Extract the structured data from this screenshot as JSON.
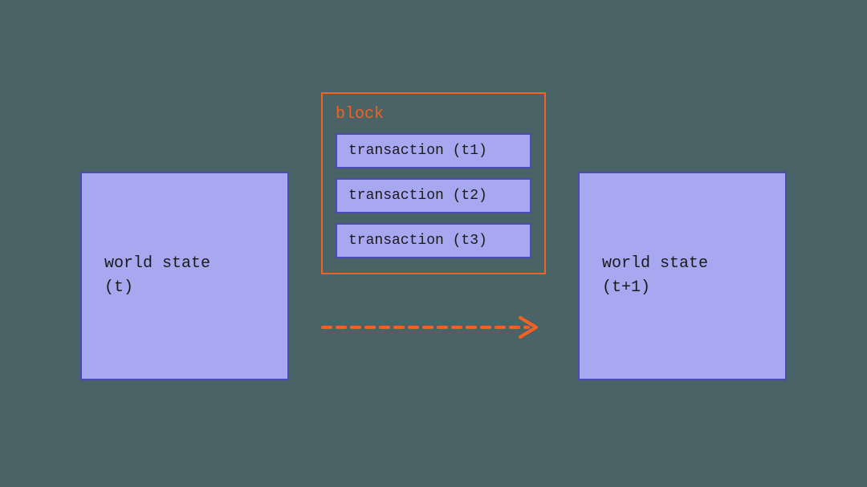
{
  "left_state": {
    "line1": "world state",
    "line2": "(t)"
  },
  "right_state": {
    "line1": "world state",
    "line2": "(t+1)"
  },
  "block": {
    "title": "block",
    "transactions": [
      "transaction (t1)",
      "transaction (t2)",
      "transaction (t3)"
    ]
  },
  "colors": {
    "background": "#4a6366",
    "box_fill": "#a8a8f0",
    "box_border": "#4b4bb5",
    "accent": "#f26322"
  }
}
